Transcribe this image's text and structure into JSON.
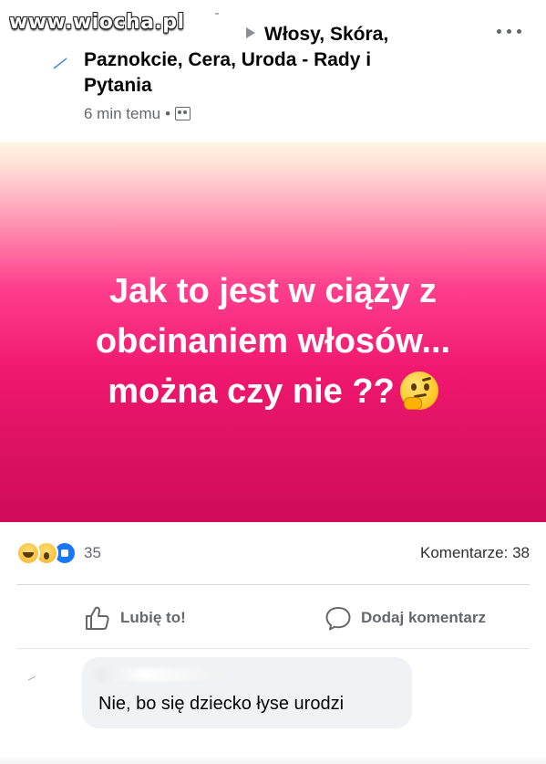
{
  "watermark": "www.wiocha.pl",
  "post": {
    "group_name_line1": "Włosy, Skóra,",
    "group_name_line2": "Paznokcie, Cera, Uroda - Rady i",
    "group_name_line3": "Pytania",
    "timestamp": "6 min temu",
    "meta_separator": "•",
    "audience_icon": "group-icon",
    "body_line1": "Jak to jest w ciąży z",
    "body_line2": "obcinaniem włosów...",
    "body_line3": "można czy nie ??",
    "body_emoji": "thinking-face-icon",
    "background_colors": [
      "#fff5e6",
      "#ff3f8d",
      "#cf0c5a"
    ]
  },
  "reactions": {
    "icons": [
      "haha-icon",
      "wow-icon",
      "like-icon"
    ],
    "count": "35",
    "comments_label": "Komentarze: 38"
  },
  "actions": {
    "like_label": "Lubię to!",
    "comment_label": "Dodaj komentarz"
  },
  "comment": {
    "text": "Nie, bo się dziecko łyse urodzi"
  },
  "colors": {
    "secondary_text": "#65676b",
    "primary_text": "#050505",
    "bubble": "#f0f2f5",
    "like_blue": "#1877f2"
  }
}
